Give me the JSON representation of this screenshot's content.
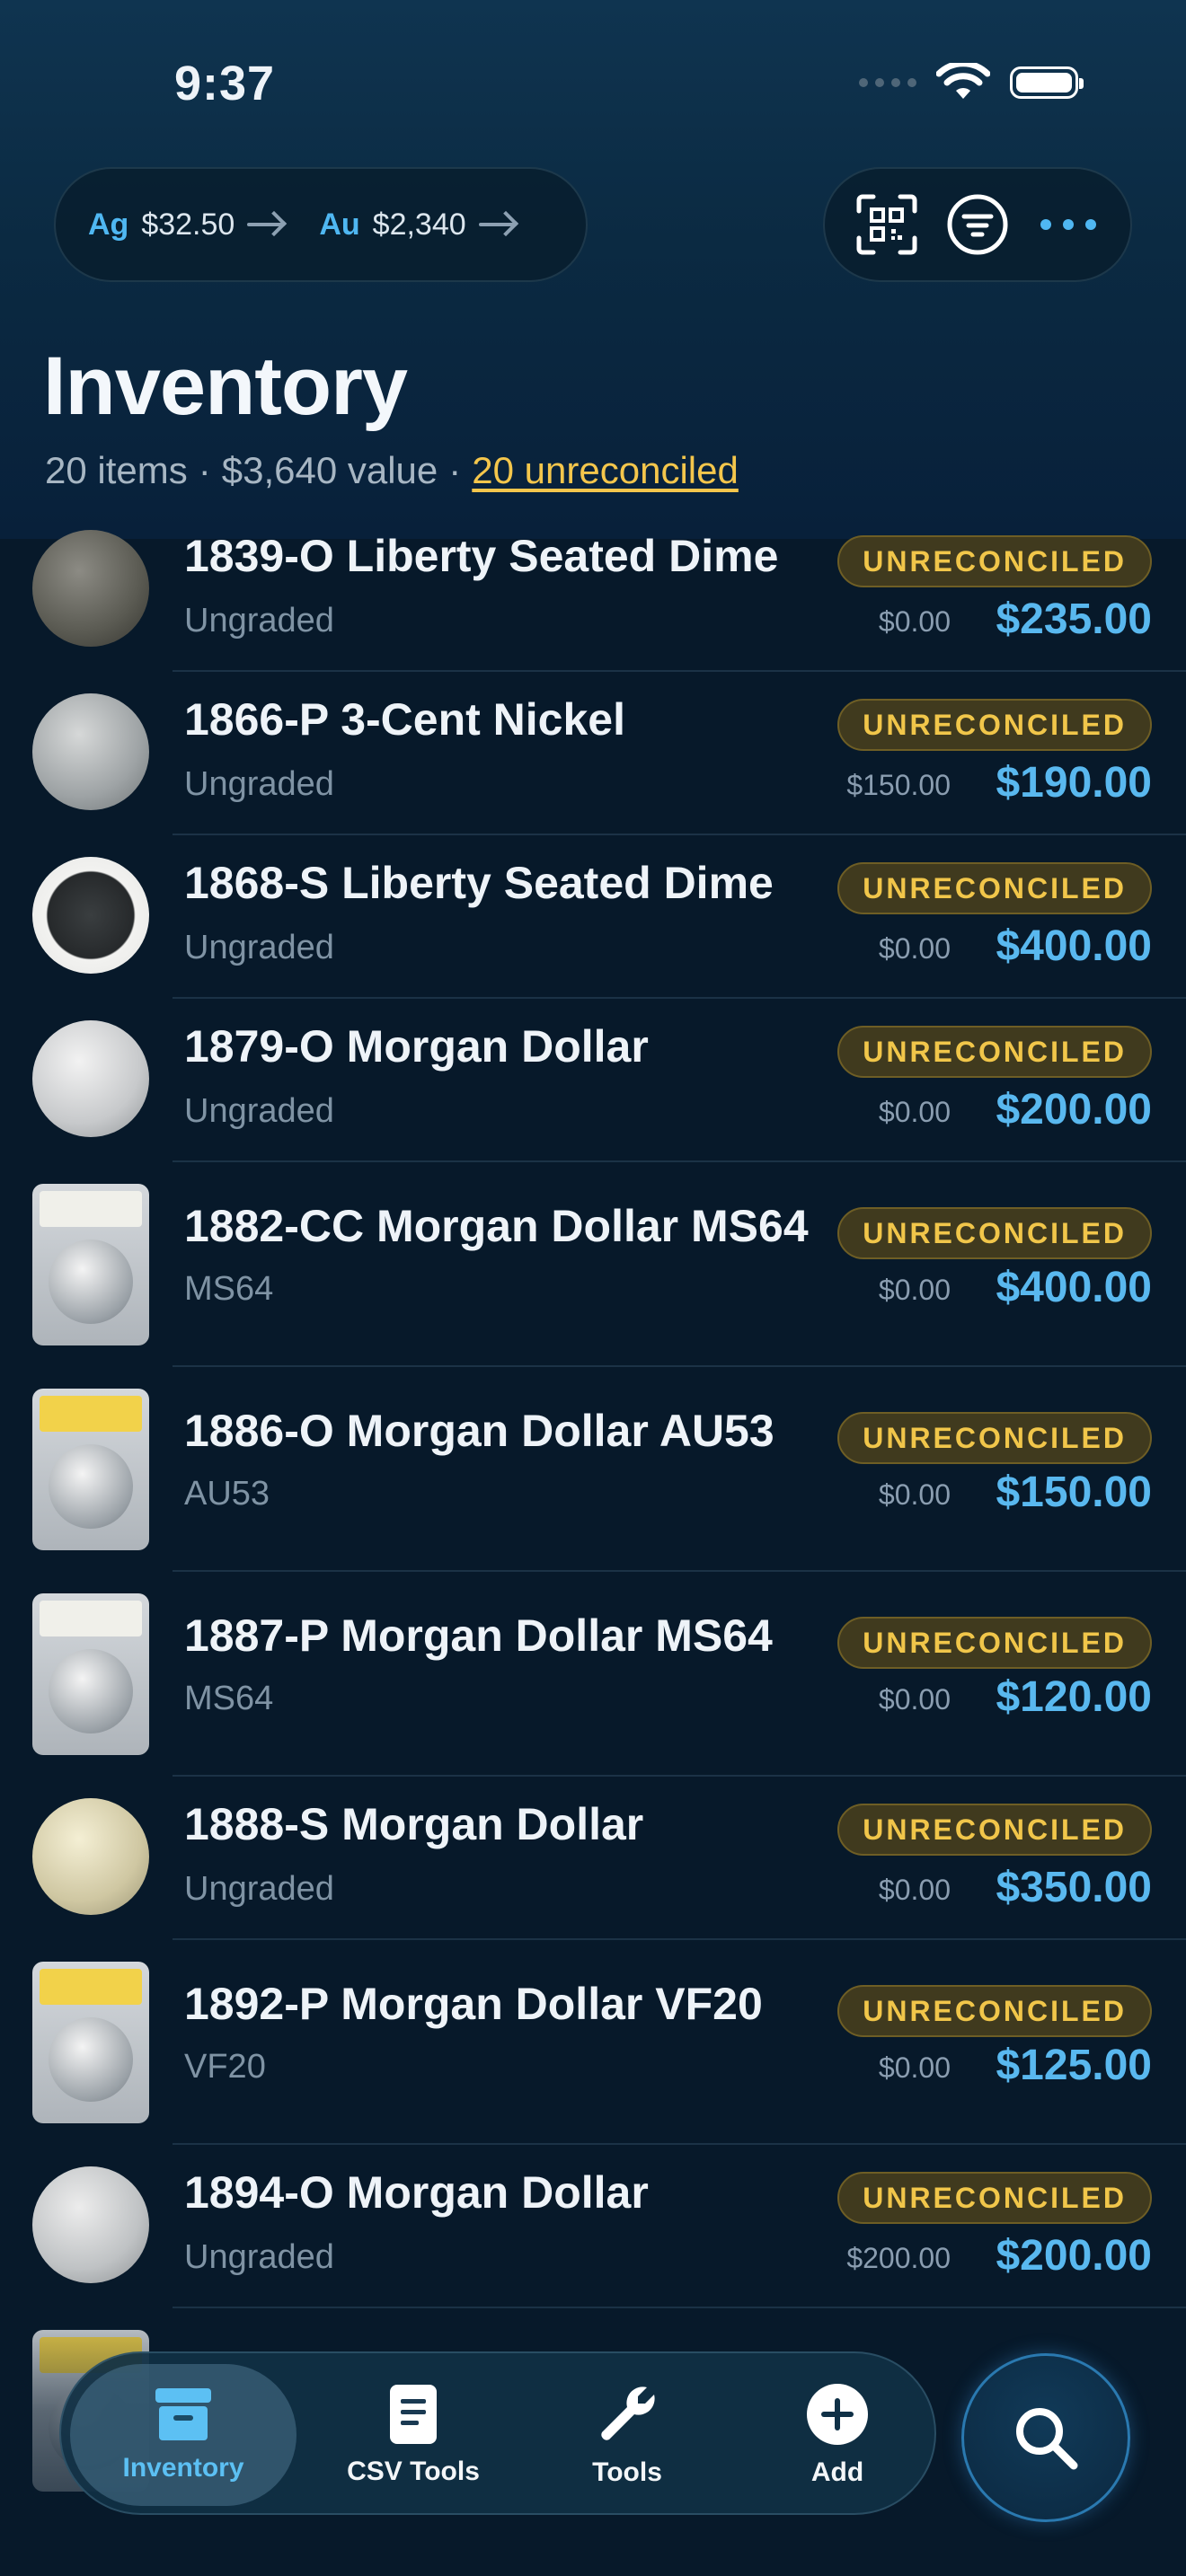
{
  "status_bar": {
    "time": "9:37"
  },
  "header": {
    "metals": [
      {
        "symbol": "Ag",
        "price": "$32.50"
      },
      {
        "symbol": "Au",
        "price": "$2,340"
      }
    ],
    "actions": [
      "qr-scan-icon",
      "filter-icon",
      "more-icon"
    ]
  },
  "page": {
    "title": "Inventory",
    "item_count": "20 items",
    "total_value": "$3,640 value",
    "unreconciled_link": "20 unreconciled"
  },
  "items": [
    {
      "name": "1839-O Liberty Seated Dime",
      "grade": "Ungraded",
      "status": "UNRECONCILED",
      "cost": "$0.00",
      "value": "$235.00"
    },
    {
      "name": "1866-P 3-Cent Nickel",
      "grade": "Ungraded",
      "status": "UNRECONCILED",
      "cost": "$150.00",
      "value": "$190.00"
    },
    {
      "name": "1868-S Liberty Seated Dime",
      "grade": "Ungraded",
      "status": "UNRECONCILED",
      "cost": "$0.00",
      "value": "$400.00"
    },
    {
      "name": "1879-O Morgan Dollar",
      "grade": "Ungraded",
      "status": "UNRECONCILED",
      "cost": "$0.00",
      "value": "$200.00"
    },
    {
      "name": "1882-CC Morgan Dollar MS64",
      "grade": "MS64",
      "status": "UNRECONCILED",
      "cost": "$0.00",
      "value": "$400.00"
    },
    {
      "name": "1886-O Morgan Dollar AU53",
      "grade": "AU53",
      "status": "UNRECONCILED",
      "cost": "$0.00",
      "value": "$150.00"
    },
    {
      "name": "1887-P Morgan Dollar MS64",
      "grade": "MS64",
      "status": "UNRECONCILED",
      "cost": "$0.00",
      "value": "$120.00"
    },
    {
      "name": "1888-S Morgan Dollar",
      "grade": "Ungraded",
      "status": "UNRECONCILED",
      "cost": "$0.00",
      "value": "$350.00"
    },
    {
      "name": "1892-P Morgan Dollar VF20",
      "grade": "VF20",
      "status": "UNRECONCILED",
      "cost": "$0.00",
      "value": "$125.00"
    },
    {
      "name": "1894-O Morgan Dollar",
      "grade": "Ungraded",
      "status": "UNRECONCILED",
      "cost": "$200.00",
      "value": "$200.00"
    }
  ],
  "tabs": [
    {
      "label": "Inventory",
      "icon": "archive-box-icon",
      "active": true
    },
    {
      "label": "CSV Tools",
      "icon": "document-icon",
      "active": false
    },
    {
      "label": "Tools",
      "icon": "wrench-icon",
      "active": false
    },
    {
      "label": "Add",
      "icon": "plus-circle-icon",
      "active": false
    }
  ],
  "search": {
    "icon": "search-icon"
  },
  "colors": {
    "accent": "#59b8ef",
    "badge": "#f1c64a",
    "background": "#07192a"
  }
}
